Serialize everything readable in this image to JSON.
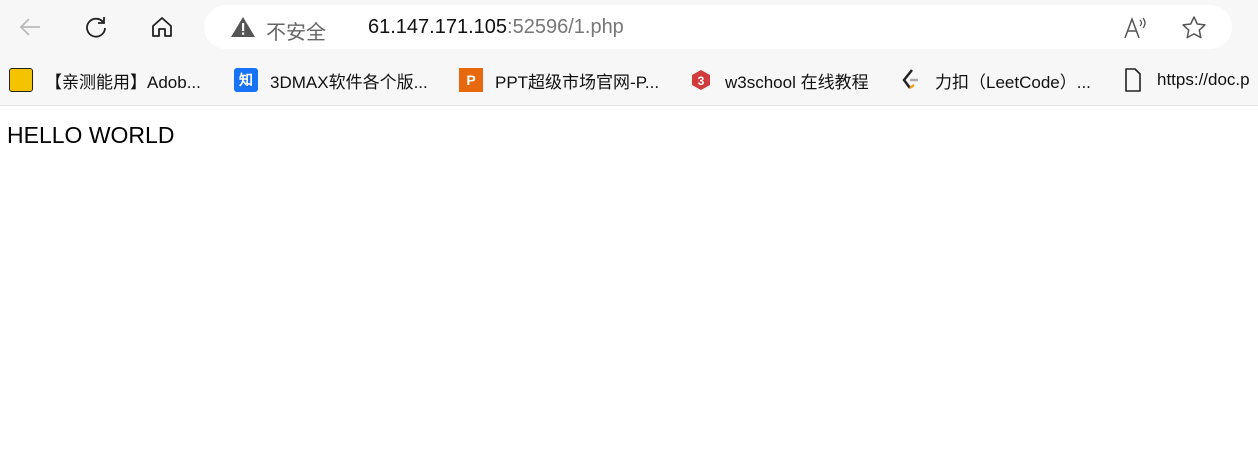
{
  "browser": {
    "security_label": "不安全",
    "url_host": "61.147.171.105",
    "url_rest": ":52596/1.php",
    "bookmarks": [
      {
        "label": "【亲测能用】Adob...",
        "icon": "yellow-app-icon",
        "color": "#f5c400"
      },
      {
        "label": "3DMAX软件各个版...",
        "icon": "zhihu-icon",
        "color": "#1772f6",
        "glyph": "知"
      },
      {
        "label": "PPT超级市场官网-P...",
        "icon": "ppt-market-icon",
        "color": "#e8680c",
        "glyph": "P"
      },
      {
        "label": "w3school 在线教程",
        "icon": "w3school-icon",
        "color": "#d23b3b"
      },
      {
        "label": "力扣（LeetCode）...",
        "icon": "leetcode-icon",
        "color": "#f89f1b"
      },
      {
        "label": "https://doc.p",
        "icon": "page-icon"
      }
    ]
  },
  "page": {
    "text": "HELLO WORLD"
  }
}
